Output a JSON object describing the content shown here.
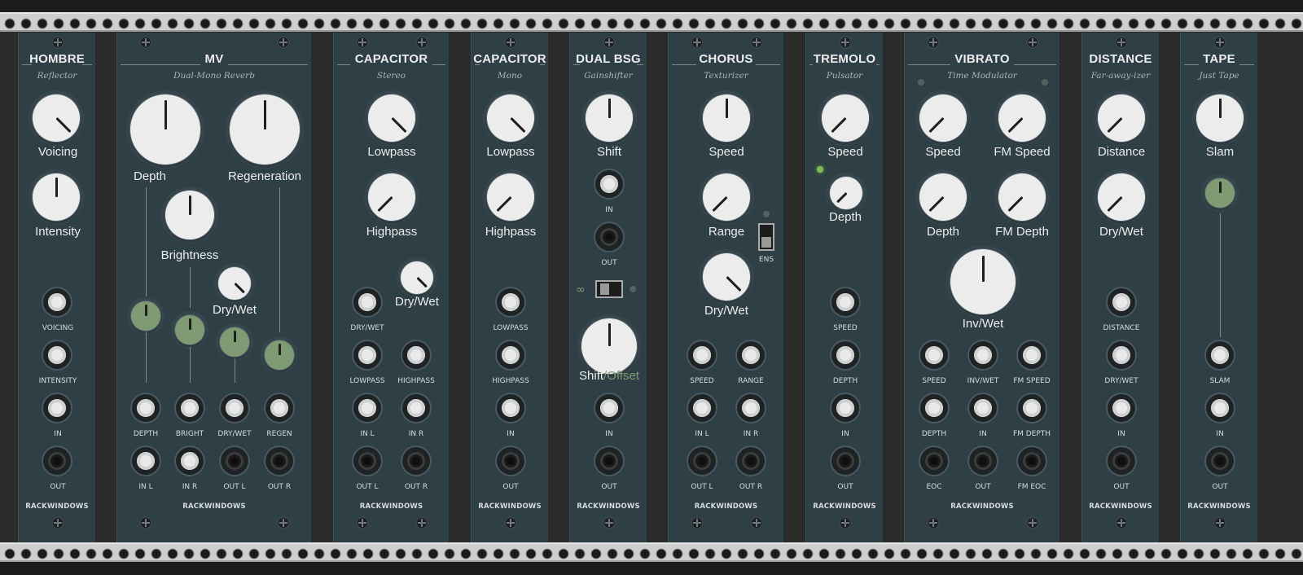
{
  "rack": {
    "brand": "RACKWINDOWS",
    "colors": {
      "panel": "#2f3f46",
      "knob": "#ececec",
      "knob_trim": "#7f9b74",
      "rail": "#cfcfcf",
      "led_on": "#7dbb4e"
    }
  },
  "modules": {
    "hombre": {
      "title": "HOMBRE",
      "subtitle": "Reflector",
      "knobs": {
        "voicing": "Voicing",
        "intensity": "Intensity"
      },
      "jacks": {
        "voicing": "VOICING",
        "intensity": "INTENSITY",
        "in": "IN",
        "out": "OUT"
      }
    },
    "mv": {
      "title": "MV",
      "subtitle": "Dual-Mono Reverb",
      "knobs": {
        "depth": "Depth",
        "regeneration": "Regeneration",
        "brightness": "Brightness",
        "drywet": "Dry/Wet"
      },
      "jacks": {
        "depth": "DEPTH",
        "bright": "BRIGHT",
        "drywet": "DRY/WET",
        "regen": "REGEN",
        "in_l": "IN L",
        "in_r": "IN R",
        "out_l": "OUT L",
        "out_r": "OUT R"
      }
    },
    "capacitor_stereo": {
      "title": "CAPACITOR",
      "subtitle": "Stereo",
      "knobs": {
        "lowpass": "Lowpass",
        "highpass": "Highpass",
        "drywet": "Dry/Wet"
      },
      "jacks": {
        "drywet": "DRY/WET",
        "lowpass": "LOWPASS",
        "highpass": "HIGHPASS",
        "in_l": "IN L",
        "in_r": "IN R",
        "out_l": "OUT L",
        "out_r": "OUT R"
      }
    },
    "capacitor_mono": {
      "title": "CAPACITOR",
      "subtitle": "Mono",
      "knobs": {
        "lowpass": "Lowpass",
        "highpass": "Highpass"
      },
      "jacks": {
        "lowpass": "LOWPASS",
        "highpass": "HIGHPASS",
        "in": "IN",
        "out": "OUT"
      }
    },
    "dual_bsg": {
      "title": "DUAL BSG",
      "subtitle": "Gainshifter",
      "knobs": {
        "shift": "Shift",
        "shift_offset_a": "Shift",
        "shift_offset_sep": "/",
        "shift_offset_b": "Offset"
      },
      "jacks": {
        "in_top": "IN",
        "out_top": "OUT",
        "in": "IN",
        "out": "OUT"
      }
    },
    "chorus": {
      "title": "CHORUS",
      "subtitle": "Texturizer",
      "knobs": {
        "speed": "Speed",
        "range": "Range",
        "drywet": "Dry/Wet"
      },
      "switch_label": "ENS",
      "jacks": {
        "speed": "SPEED",
        "range": "RANGE",
        "in_l": "IN L",
        "in_r": "IN R",
        "out_l": "OUT L",
        "out_r": "OUT R"
      }
    },
    "tremolo": {
      "title": "TREMOLO",
      "subtitle": "Pulsator",
      "knobs": {
        "speed": "Speed",
        "depth": "Depth"
      },
      "jacks": {
        "speed": "SPEED",
        "depth": "DEPTH",
        "in": "IN",
        "out": "OUT"
      }
    },
    "vibrato": {
      "title": "VIBRATO",
      "subtitle": "Time Modulator",
      "knobs": {
        "speed": "Speed",
        "fm_speed": "FM Speed",
        "depth": "Depth",
        "fm_depth": "FM Depth",
        "invwet": "Inv/Wet"
      },
      "jacks": {
        "speed": "SPEED",
        "invwet": "INV/WET",
        "fm_speed": "FM SPEED",
        "depth": "DEPTH",
        "in": "IN",
        "fm_depth": "FM DEPTH",
        "eoc": "EOC",
        "out": "OUT",
        "fm_eoc": "FM EOC"
      }
    },
    "distance": {
      "title": "DISTANCE",
      "subtitle": "Far-away-izer",
      "knobs": {
        "distance": "Distance",
        "drywet": "Dry/Wet"
      },
      "jacks": {
        "distance": "DISTANCE",
        "drywet": "DRY/WET",
        "in": "IN",
        "out": "OUT"
      }
    },
    "tape": {
      "title": "TAPE",
      "subtitle": "Just Tape",
      "knobs": {
        "slam": "Slam"
      },
      "jacks": {
        "slam": "SLAM",
        "in": "IN",
        "out": "OUT"
      }
    }
  }
}
